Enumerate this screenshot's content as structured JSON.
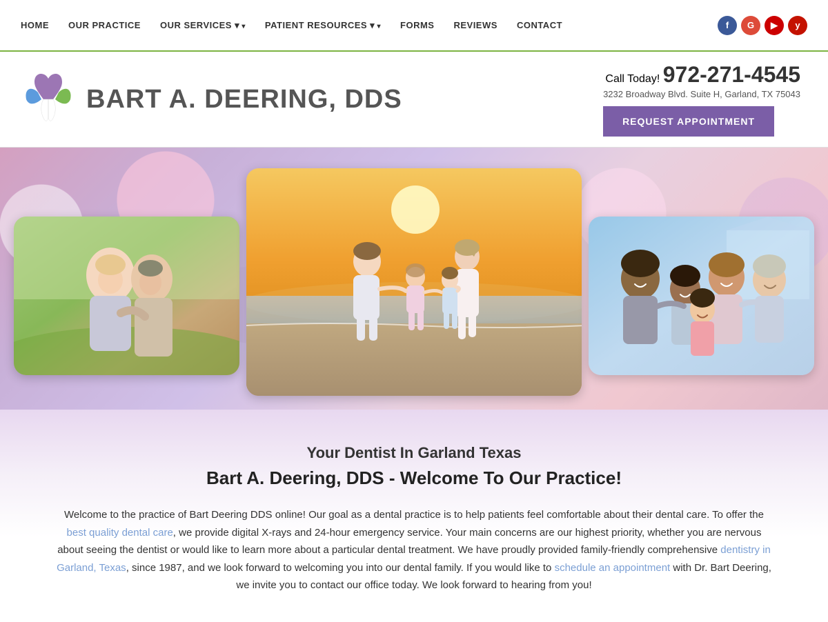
{
  "nav": {
    "links": [
      {
        "label": "HOME",
        "id": "home",
        "hasDropdown": false
      },
      {
        "label": "OUR PRACTICE",
        "id": "our-practice",
        "hasDropdown": false
      },
      {
        "label": "OUR SERVICES",
        "id": "our-services",
        "hasDropdown": true
      },
      {
        "label": "PATIENT RESOURCES",
        "id": "patient-resources",
        "hasDropdown": true
      },
      {
        "label": "FORMS",
        "id": "forms",
        "hasDropdown": false
      },
      {
        "label": "REVIEWS",
        "id": "reviews",
        "hasDropdown": false
      },
      {
        "label": "CONTACT",
        "id": "contact",
        "hasDropdown": false
      }
    ],
    "social": [
      {
        "id": "facebook",
        "label": "f",
        "class": "fb"
      },
      {
        "id": "google",
        "label": "G",
        "class": "gp"
      },
      {
        "id": "youtube",
        "label": "▶",
        "class": "yt"
      },
      {
        "id": "yelp",
        "label": "y",
        "class": "yelp"
      }
    ]
  },
  "header": {
    "practice_name": "BART A. DEERING, DDS",
    "call_label": "Call Today!",
    "phone": "972-271-4545",
    "address": "3232 Broadway Blvd. Suite H, Garland, TX 75043",
    "request_button": "REQUEST APPOINTMENT"
  },
  "hero": {
    "photos": [
      {
        "id": "elderly-couple",
        "alt": "Elderly couple smiling"
      },
      {
        "id": "family-beach",
        "alt": "Family walking on beach"
      },
      {
        "id": "family-group",
        "alt": "Happy family group"
      }
    ]
  },
  "content": {
    "subtitle": "Your Dentist In Garland Texas",
    "main_title": "Bart A. Deering, DDS - Welcome To Our Practice!",
    "paragraph": "Welcome to the practice of Bart Deering DDS online! Our goal as a dental practice is to help patients feel comfortable about their dental care. To offer the ",
    "link1_text": "best quality dental care",
    "link1_href": "#",
    "paragraph2": ", we provide digital X-rays and 24-hour emergency service. Your main concerns are our highest priority, whether you are nervous about seeing the dentist or would like to learn more about a particular dental treatment. We have proudly provided family-friendly comprehensive ",
    "link2_text": "dentistry in Garland, Texas",
    "link2_href": "#",
    "paragraph3": ", since 1987, and we look forward to welcoming you into our dental family. If you would like to ",
    "link3_text": "schedule an appointment",
    "link3_href": "#",
    "paragraph4": " with Dr. Bart Deering, we invite you to contact our office today. We look forward to hearing from you!"
  }
}
